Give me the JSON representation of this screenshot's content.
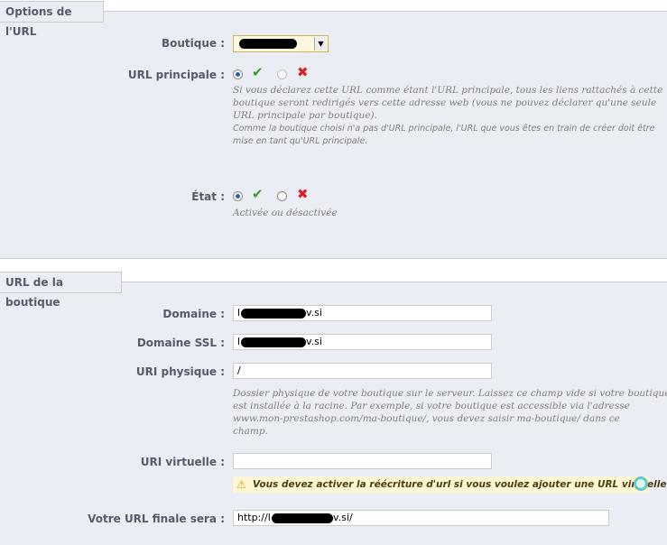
{
  "section_url_options": {
    "legend": "Options de l'URL",
    "shop_label": "Boutique :",
    "main_url_label": "URL principale :",
    "main_url_hint_1": "Si vous déclarez cette URL comme étant l'URL principale, tous les liens rattachés à cette",
    "main_url_hint_2": "boutique seront redirigés vers cette adresse web (vous ne pouvez déclarer qu'une seule",
    "main_url_hint_3": "URL principale par boutique).",
    "main_url_note_1": "Comme la boutique choisi n'a pas d'URL principale, l'URL que vous êtes en train de créer doit être",
    "main_url_note_2": "mise en tant qu'URL principale.",
    "state_label": "État :",
    "state_hint": "Activée ou désactivée"
  },
  "section_shop_url": {
    "legend": "URL de la boutique",
    "domain_label": "Domaine :",
    "domain_value_start": "l",
    "domain_value_end": "v.si",
    "ssl_label": "Domaine SSL :",
    "ssl_value_start": "l",
    "ssl_value_end": "v.si",
    "physical_label": "URI physique :",
    "physical_value": "/",
    "physical_hint_1": "Dossier physique de votre boutique sur le serveur. Laissez ce champ vide si votre boutique",
    "physical_hint_2": "est installée à la racine. Par exemple, si votre boutique est accessible via l'adresse",
    "physical_hint_3": "www.mon-prestashop.com/ma-boutique/, vous devez saisir ma-boutique/ dans ce",
    "physical_hint_4": "champ.",
    "virtual_label": "URI virtuelle :",
    "virtual_value": "",
    "warning": "Vous devez activer la réécriture d'url si vous voulez ajouter une URL virtuelle",
    "final_label": "Votre URL finale sera :",
    "final_value_start": "http://l",
    "final_value_end": "v.si/"
  },
  "icons": {
    "check": "check-icon",
    "cross": "cross-icon",
    "warning": "warning-icon",
    "select_arrow": "chevron-down-icon"
  },
  "colors": {
    "panel_bg": "#ebedf4",
    "label_color": "#585a69",
    "radio_checked": "#2a5db0",
    "check": "#3a9b2e",
    "cross": "#d52222",
    "warning_bg": "#fff6d3"
  }
}
